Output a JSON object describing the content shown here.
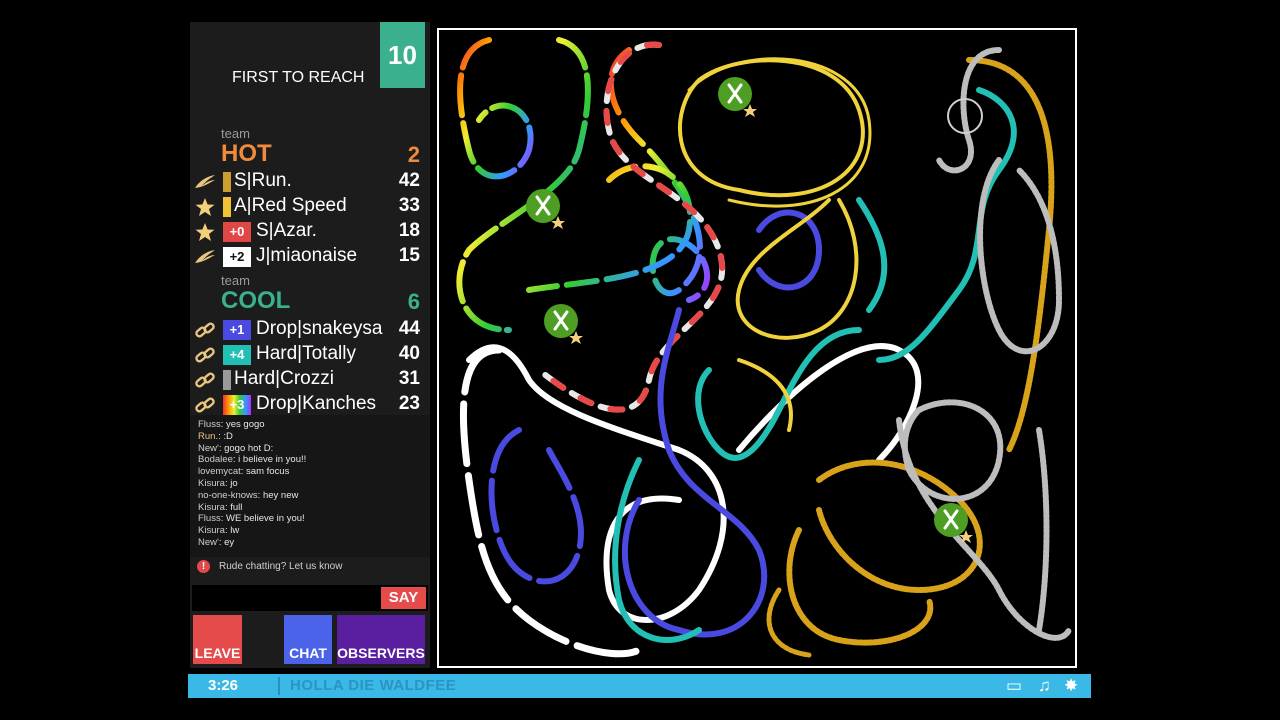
{
  "header": {
    "first_to_reach_label": "FIRST TO REACH",
    "first_to_reach_value": "10"
  },
  "teams": [
    {
      "label": "team",
      "name": "HOT",
      "score": "2",
      "color": "#f08a3c",
      "players": [
        {
          "icon": "wings-icon",
          "badge": "",
          "badge_color": "#c9a030",
          "name": "S|Run.",
          "score": "42"
        },
        {
          "icon": "star-icon",
          "badge": "",
          "badge_color": "#f1c232",
          "name": "A|Red Speed",
          "score": "33"
        },
        {
          "icon": "star-icon",
          "badge": "+0",
          "badge_color": "#e04848",
          "name": "S|Azar.",
          "score": "18"
        },
        {
          "icon": "wings-icon",
          "badge": "+2",
          "badge_color": "#ffffff",
          "name": "J|miaonaise",
          "score": "15"
        }
      ]
    },
    {
      "label": "team",
      "name": "COOL",
      "score": "6",
      "color": "#3bb08f",
      "players": [
        {
          "icon": "chain-link-icon",
          "badge": "+1",
          "badge_color": "#4a4ae0",
          "name": "Drop|snakeysa",
          "score": "44"
        },
        {
          "icon": "chain-link-icon",
          "badge": "+4",
          "badge_color": "#22c0b4",
          "name": "Hard|Totally",
          "score": "40"
        },
        {
          "icon": "chain-link-icon",
          "badge": "",
          "badge_color": "#9a9a9a",
          "name": "Hard|Crozzi",
          "score": "31"
        },
        {
          "icon": "chain-link-icon",
          "badge": "+3",
          "badge_color": "rainbow",
          "name": "Drop|Kanches",
          "score": "23"
        }
      ]
    }
  ],
  "chat": {
    "messages": [
      {
        "user": "Fluss",
        "text": "yes gogo"
      },
      {
        "user": "Run.",
        "text": ":D"
      },
      {
        "user": "New'",
        "text": "gogo hot D:"
      },
      {
        "user": "Bodalee",
        "text": "i believe in you!!"
      },
      {
        "user": "lovemycat",
        "text": "sam focus"
      },
      {
        "user": "Kisura",
        "text": "jo"
      },
      {
        "user": "no-one-knows",
        "text": "hey new"
      },
      {
        "user": "Kisura",
        "text": "full"
      },
      {
        "user": "Fluss",
        "text": "WE believe in you!"
      },
      {
        "user": "Kisura",
        "text": "lw"
      },
      {
        "user": "New'",
        "text": "ey"
      }
    ],
    "rude_notice": "Rude chatting? Let us know",
    "input_value": "",
    "say_label": "SAY"
  },
  "buttons": {
    "leave": "LEAVE",
    "chat": "CHAT",
    "observers": "OBSERVERS"
  },
  "bottom_bar": {
    "time": "3:26",
    "song": "HOLLA DIE WALDFEE"
  },
  "colors": {
    "hot": "#f08a3c",
    "cool": "#3bb08f",
    "leave": "#e54b4b",
    "chat": "#4a63e8",
    "observers": "#5a1fa0",
    "bar": "#3ab8e6"
  }
}
